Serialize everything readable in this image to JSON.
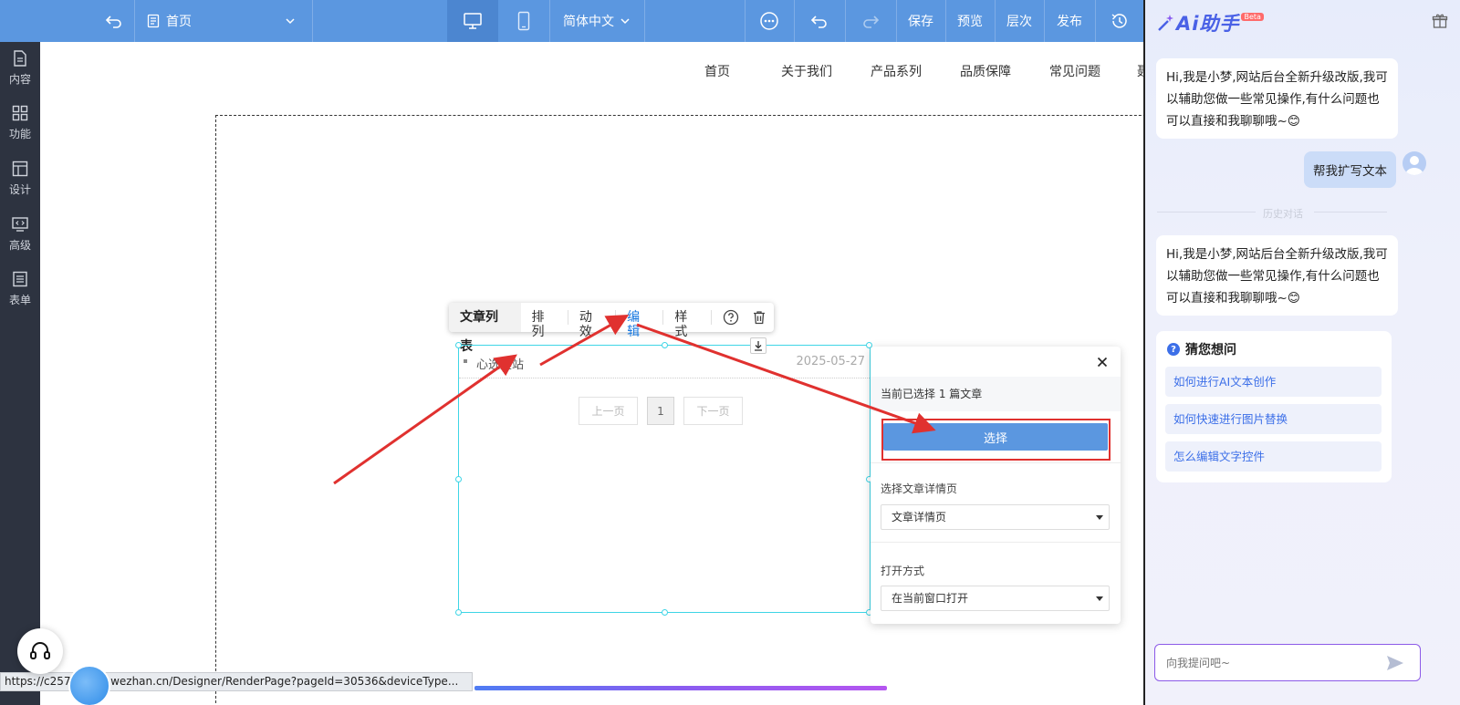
{
  "toolbar": {
    "page_label": "首页",
    "language": "简体中文",
    "save": "保存",
    "preview": "预览",
    "layers": "层次",
    "publish": "发布"
  },
  "sidebar": {
    "items": [
      {
        "label": "内容",
        "icon": "document-icon"
      },
      {
        "label": "功能",
        "icon": "grid-icon"
      },
      {
        "label": "设计",
        "icon": "layout-icon"
      },
      {
        "label": "高级",
        "icon": "code-monitor-icon"
      },
      {
        "label": "表单",
        "icon": "list-icon"
      }
    ]
  },
  "site_nav": [
    "首页",
    "关于我们",
    "产品系列",
    "品质保障",
    "常见问题",
    "聂"
  ],
  "component_toolbar": {
    "title": "文章列表",
    "arrange": "排列",
    "animation": "动效",
    "edit": "编辑",
    "style": "样式"
  },
  "article_list": {
    "items": [
      {
        "title": "心选建站",
        "date": "2025-05-27"
      }
    ],
    "pager": {
      "prev": "上一页",
      "current": "1",
      "next": "下一页"
    }
  },
  "popup": {
    "selected_info": "当前已选择 1 篇文章",
    "select_button": "选择",
    "detail_page_label": "选择文章详情页",
    "detail_page_value": "文章详情页",
    "open_mode_label": "打开方式",
    "open_mode_value": "在当前窗口打开"
  },
  "status_url": "https://c257            sy.scd.wezhan.cn/Designer/RenderPage?pageId=30536&deviceType...",
  "ai_panel": {
    "logo": "Ai助手",
    "beta": "Beta",
    "greeting": "Hi,我是小梦,网站后台全新升级改版,我可以辅助您做一些常见操作,有什么问题也可以直接和我聊聊哦~😊",
    "user_message": "帮我扩写文本",
    "history_label": "历史对话",
    "greeting_2": "Hi,我是小梦,网站后台全新升级改版,我可以辅助您做一些常见操作,有什么问题也可以直接和我聊聊哦~😊",
    "guess_title": "猜您想问",
    "guess_items": [
      "如何进行AI文本创作",
      "如何快速进行图片替换",
      "怎么编辑文字控件"
    ],
    "input_placeholder": "向我提问吧~"
  },
  "colors": {
    "toolbar_bg": "#5b97e0",
    "sidebar_bg": "#2d3340",
    "selection_border": "#3fd5e6",
    "annotation_red": "#e0312f",
    "ai_accent": "#4a61e6"
  }
}
